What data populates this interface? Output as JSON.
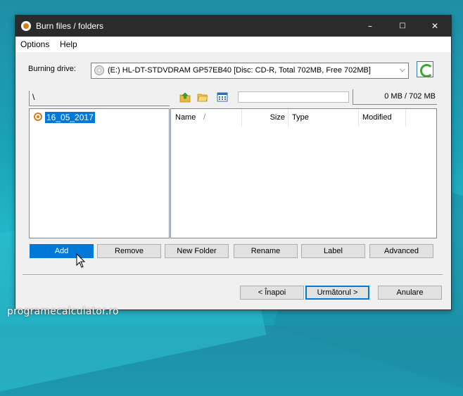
{
  "window": {
    "title": "Burn files / folders",
    "minimize": "–",
    "maximize": "□",
    "close": "✕"
  },
  "menu": [
    "Options",
    "Help"
  ],
  "drive": {
    "label": "Burning drive:",
    "selected": "(E:) HL-DT-STDVDRAM GP57EB40 [Disc: CD-R, Total 702MB, Free 702MB]",
    "dropdown_icon": "chevron-down-icon"
  },
  "toolbar": {
    "path": "\\",
    "size_text": "0 MB / 702 MB",
    "progress_fraction": 0
  },
  "tree": {
    "items": [
      "16_05_2017"
    ]
  },
  "list": {
    "columns": [
      "Name",
      "Size",
      "Type",
      "Modified"
    ],
    "sort_indicator": "/"
  },
  "actions": [
    "Add",
    "Remove",
    "New Folder",
    "Rename",
    "Label",
    "Advanced"
  ],
  "nav": {
    "back": "< Înapoi",
    "next": "Următorul >",
    "cancel": "Anulare"
  },
  "watermark": "programecalculator.ro"
}
